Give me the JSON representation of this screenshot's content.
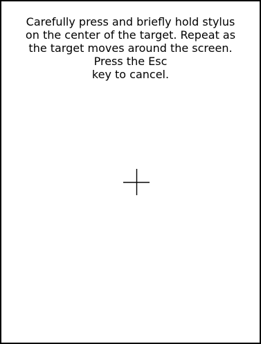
{
  "calibration": {
    "instruction_lines": [
      "Carefully press and briefly hold stylus",
      "on the center of the target. Repeat as",
      "the target moves around the screen.",
      "Press the Esc",
      "key to cancel."
    ],
    "target_icon": "crosshair-icon"
  },
  "colors": {
    "background": "#ffffff",
    "foreground": "#000000"
  }
}
